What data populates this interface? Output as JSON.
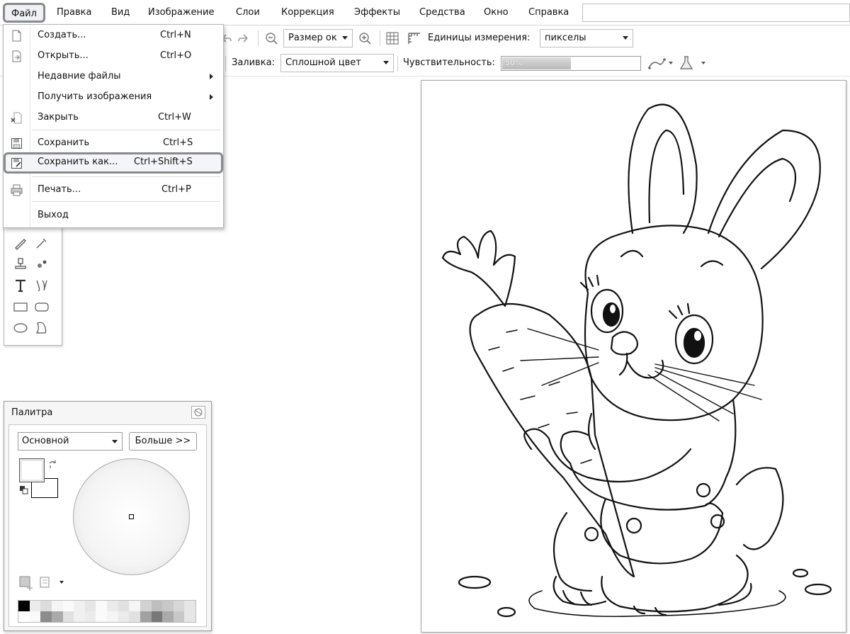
{
  "menubar": {
    "items": [
      "Файл",
      "Правка",
      "Вид",
      "Изображение",
      "Слои",
      "Коррекция",
      "Эффекты",
      "Средства",
      "Окно",
      "Справка"
    ]
  },
  "toolbar1": {
    "zoom_value": "Размер ок",
    "units_label": "Единицы измерения:",
    "units_value": "пикселы"
  },
  "toolbar2": {
    "fill_label": "Заливка:",
    "fill_value": "Сплошной цвет",
    "tolerance_label": "Чувствительность:",
    "tolerance_text": "50%",
    "tolerance_fraction": 0.5
  },
  "file_menu": {
    "items": [
      {
        "label": "Создать...",
        "shortcut": "Ctrl+N",
        "icon": "new-file-icon"
      },
      {
        "label": "Открыть...",
        "shortcut": "Ctrl+O",
        "icon": "open-file-icon"
      },
      {
        "label": "Недавние файлы",
        "shortcut": "",
        "submenu": true
      },
      {
        "label": "Получить изображения",
        "shortcut": "",
        "submenu": true
      },
      {
        "label": "Закрыть",
        "shortcut": "Ctrl+W",
        "icon": "close-file-icon"
      },
      {
        "label": "Сохранить",
        "shortcut": "Ctrl+S",
        "icon": "save-icon"
      },
      {
        "label": "Сохранить как...",
        "shortcut": "Ctrl+Shift+S",
        "icon": "save-as-icon",
        "highlighted": true
      },
      {
        "label": "Печать...",
        "shortcut": "Ctrl+P",
        "icon": "print-icon"
      },
      {
        "label": "Выход",
        "shortcut": ""
      }
    ]
  },
  "palette": {
    "title": "Палитра",
    "mode": "Основной",
    "more_button": "Больше >>",
    "primary_color": "#ffffff",
    "secondary_color": "#ffffff"
  },
  "colors": {
    "highlight_border": "#8a8a8a",
    "outline": "#111111"
  }
}
